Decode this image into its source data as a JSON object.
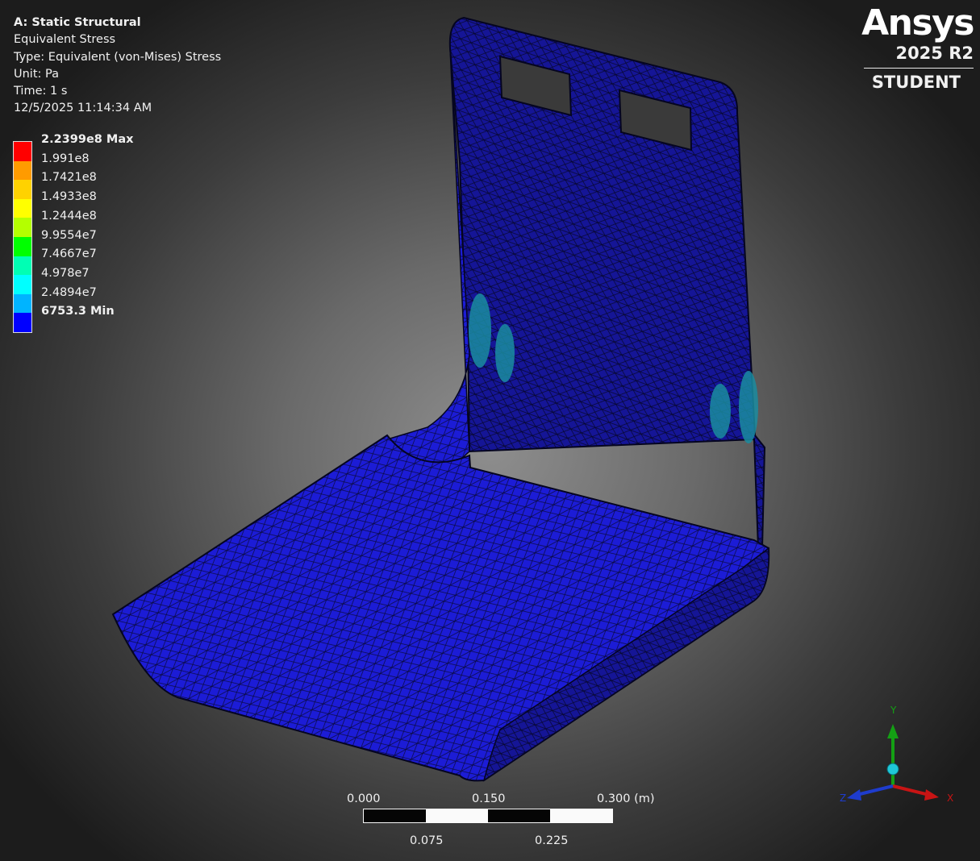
{
  "info": {
    "analysis": "A: Static Structural",
    "result": "Equivalent Stress",
    "type": "Type: Equivalent (von-Mises) Stress",
    "unit": "Unit: Pa",
    "time": "Time: 1 s",
    "timestamp": "12/5/2025 11:14:34 AM"
  },
  "legend": {
    "max_label": "2.2399e8 Max",
    "min_label": "6753.3 Min",
    "levels": [
      "1.991e8",
      "1.7421e8",
      "1.4933e8",
      "1.2444e8",
      "9.9554e7",
      "7.4667e7",
      "4.978e7",
      "2.4894e7"
    ],
    "colors": [
      "#ff0000",
      "#ff9b00",
      "#ffd200",
      "#ffff00",
      "#b4ff00",
      "#00ff00",
      "#00ffb4",
      "#00ffff",
      "#00b4ff",
      "#0000ff"
    ]
  },
  "brand": {
    "name": "Ansys",
    "version": "2025 R2",
    "edition": "STUDENT"
  },
  "scale": {
    "top_ticks": [
      "0.000",
      "0.150",
      "0.300 (m)"
    ],
    "bottom_ticks": [
      "0.075",
      "0.225"
    ]
  },
  "triad": {
    "x": "X",
    "y": "Y",
    "z": "Z",
    "x_color": "#c81414",
    "y_color": "#14a014",
    "z_color": "#1e3ccd"
  },
  "model": {
    "mesh_color": "#1a1ad8",
    "hotspot_color": "#1a8ca0"
  }
}
